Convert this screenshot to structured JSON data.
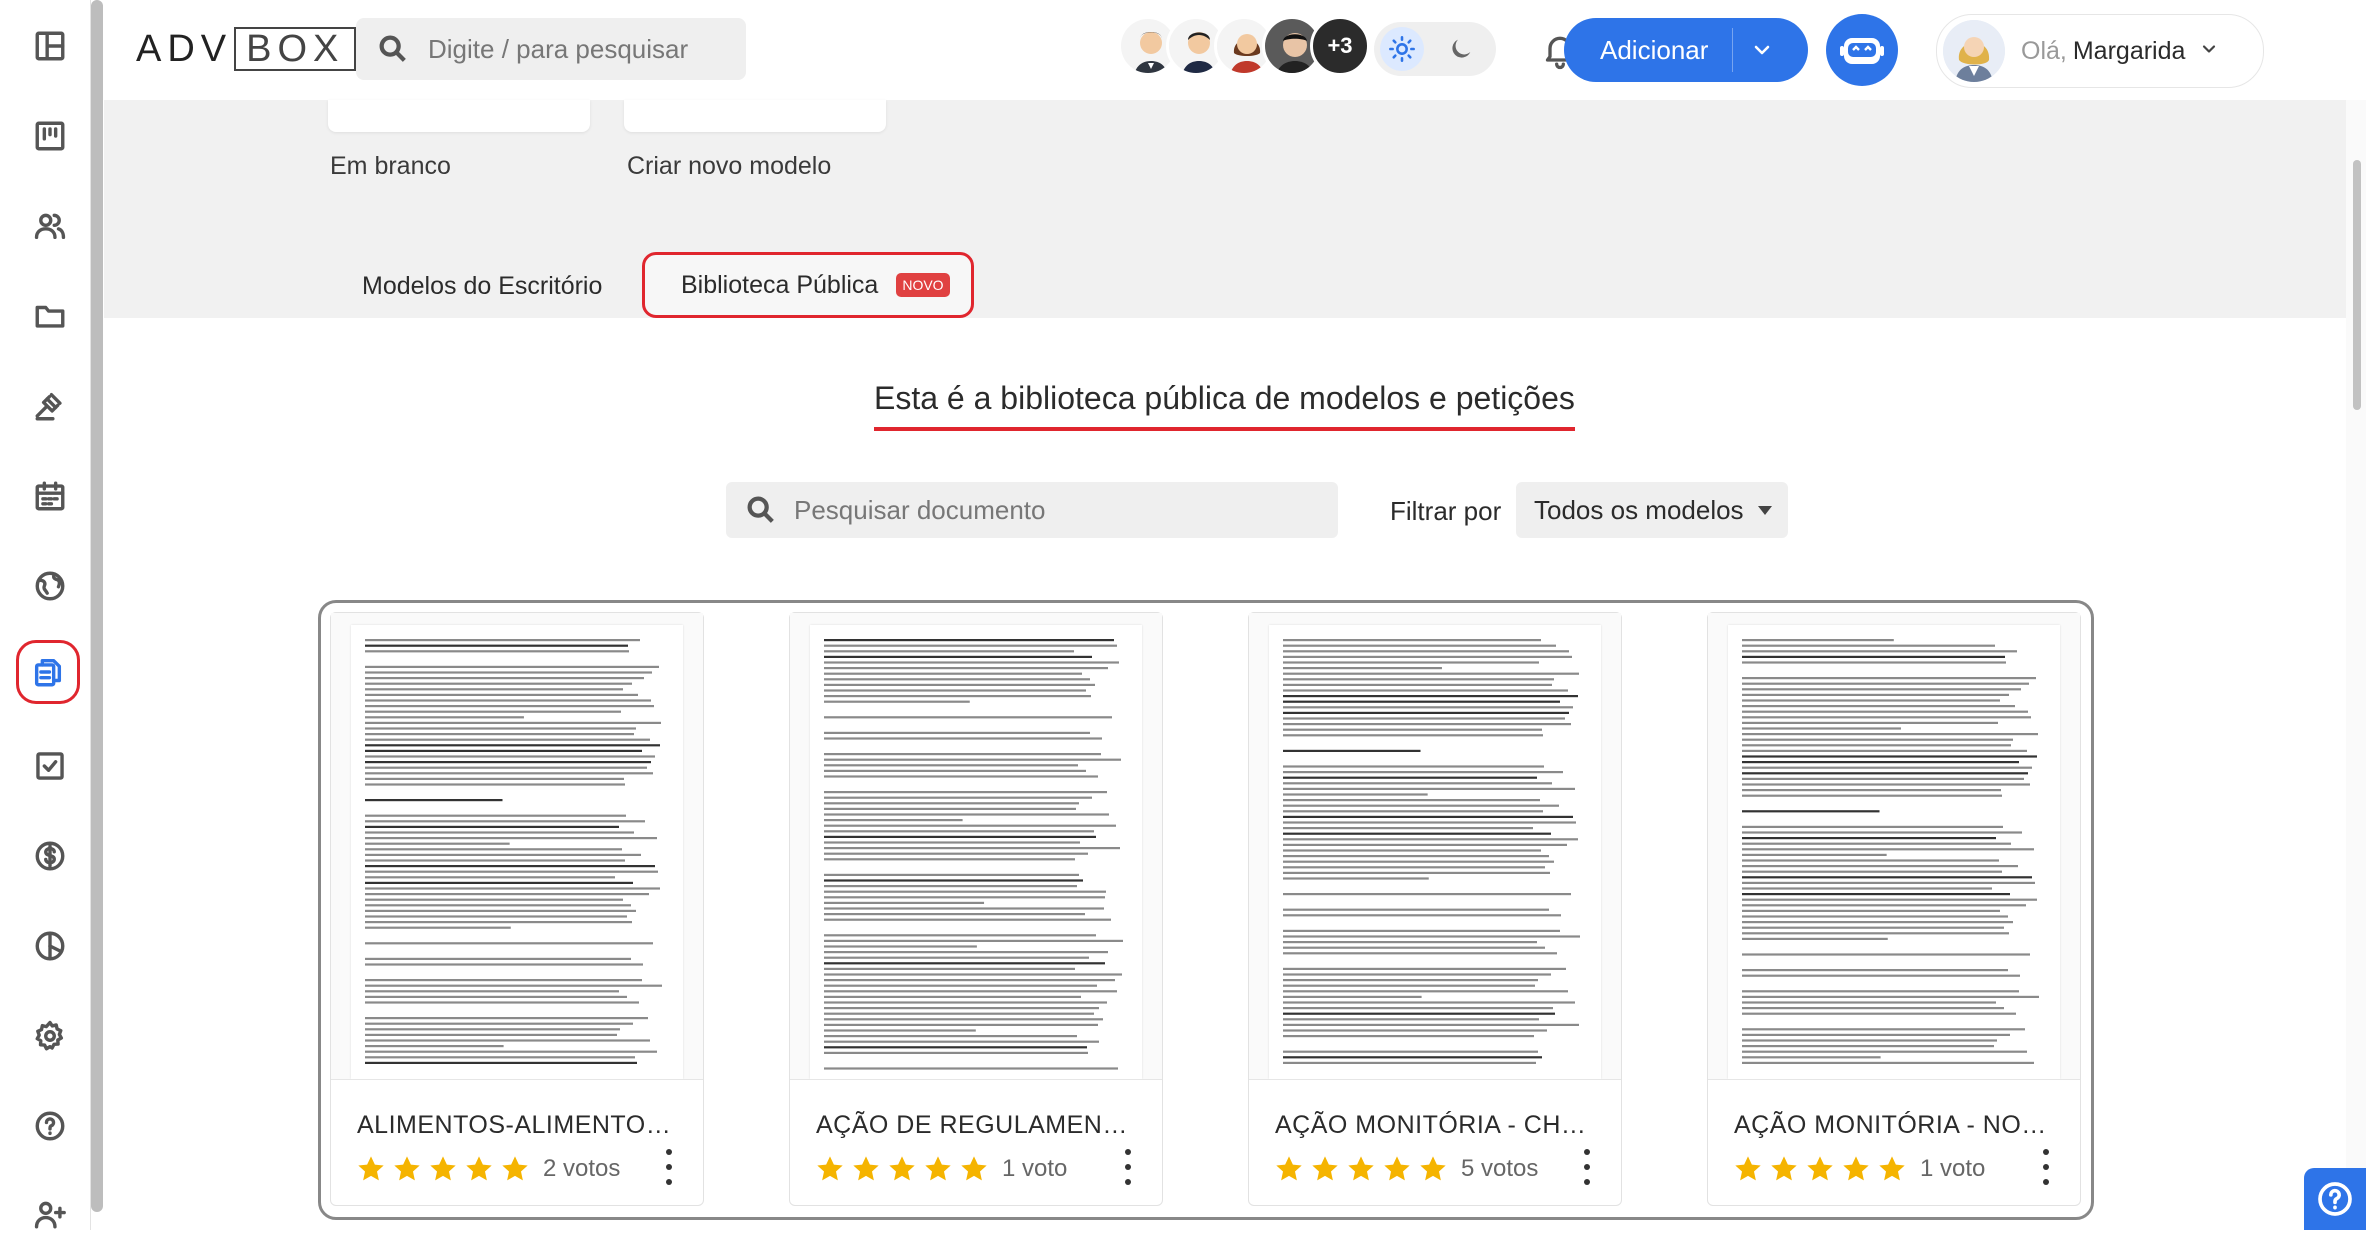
{
  "header": {
    "logo_left": "ADV",
    "logo_right": "BOX",
    "search_placeholder": "Digite / para pesquisar",
    "team_more": "+3",
    "add_button": "Adicionar",
    "greeting": "Olá,",
    "user_name": "Margarida"
  },
  "sidebar": {
    "items": [
      {
        "name": "sidebar-item-dashboard",
        "icon": "layout-icon"
      },
      {
        "name": "sidebar-item-kanban",
        "icon": "kanban-icon"
      },
      {
        "name": "sidebar-item-contacts",
        "icon": "people-icon"
      },
      {
        "name": "sidebar-item-processes",
        "icon": "folder-icon"
      },
      {
        "name": "sidebar-item-legal",
        "icon": "gavel-icon"
      },
      {
        "name": "sidebar-item-calendar",
        "icon": "calendar-icon"
      },
      {
        "name": "sidebar-item-web",
        "icon": "globe-icon"
      },
      {
        "name": "sidebar-item-documents",
        "icon": "documents-icon",
        "active": true
      },
      {
        "name": "sidebar-item-tasks",
        "icon": "checkbox-icon"
      },
      {
        "name": "sidebar-item-finance",
        "icon": "dollar-icon"
      },
      {
        "name": "sidebar-item-reports",
        "icon": "pie-chart-icon"
      },
      {
        "name": "sidebar-item-settings",
        "icon": "gear-icon"
      },
      {
        "name": "sidebar-item-help",
        "icon": "help-icon"
      },
      {
        "name": "sidebar-item-invite",
        "icon": "add-user-icon"
      }
    ]
  },
  "templates_top": {
    "blank_label": "Em branco",
    "new_model_label": "Criar novo modelo"
  },
  "tabs": {
    "office": "Modelos do Escritório",
    "public": "Biblioteca Pública",
    "public_badge": "NOVO"
  },
  "library": {
    "headline": "Esta é a biblioteca pública de modelos e petições",
    "search_placeholder": "Pesquisar documento",
    "filter_label": "Filtrar por",
    "filter_value": "Todos os modelos"
  },
  "cards": [
    {
      "title": "ALIMENTOS-ALIMENTOS...",
      "rating": 5,
      "votes": "2 votos"
    },
    {
      "title": "AÇÃO DE REGULAMENTA...",
      "rating": 5,
      "votes": "1 voto"
    },
    {
      "title": "AÇÃO MONITÓRIA - CHE...",
      "rating": 5,
      "votes": "5 votos"
    },
    {
      "title": "AÇÃO MONITÓRIA - NOT...",
      "rating": 5,
      "votes": "1 voto"
    }
  ],
  "colors": {
    "accent": "#2e74e8",
    "highlight": "#e0262e",
    "star": "#f5b400"
  }
}
